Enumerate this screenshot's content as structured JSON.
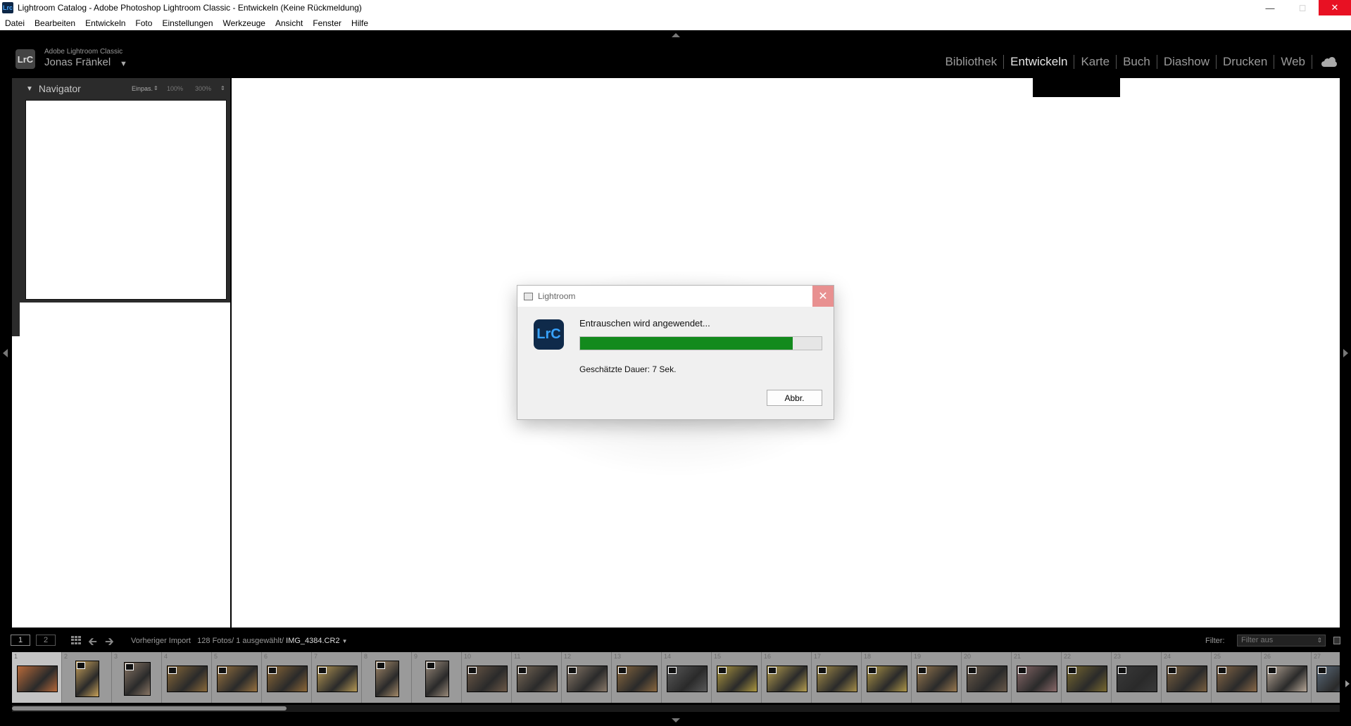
{
  "window": {
    "title": "Lightroom Catalog - Adobe Photoshop Lightroom Classic - Entwickeln (Keine Rückmeldung)",
    "app_icon": "Lrc"
  },
  "menubar": [
    "Datei",
    "Bearbeiten",
    "Entwickeln",
    "Foto",
    "Einstellungen",
    "Werkzeuge",
    "Ansicht",
    "Fenster",
    "Hilfe"
  ],
  "identity": {
    "logo": "LrC",
    "brand": "Adobe Lightroom Classic",
    "user": "Jonas Fränkel"
  },
  "modules": [
    {
      "label": "Bibliothek",
      "active": false
    },
    {
      "label": "Entwickeln",
      "active": true
    },
    {
      "label": "Karte",
      "active": false
    },
    {
      "label": "Buch",
      "active": false
    },
    {
      "label": "Diashow",
      "active": false
    },
    {
      "label": "Drucken",
      "active": false
    },
    {
      "label": "Web",
      "active": false
    }
  ],
  "navigator": {
    "title": "Navigator",
    "zoom_fit": "Einpas.",
    "zoom_100": "100%",
    "zoom_300": "300%"
  },
  "dialog": {
    "title": "Lightroom",
    "logo": "LrC",
    "message": "Entrauschen wird angewendet...",
    "progress": 0.88,
    "eta": "Geschätzte Dauer: 7 Sek.",
    "cancel_label": "Abbr."
  },
  "filmstrip_toolbar": {
    "screen1": "1",
    "screen2": "2",
    "source_prefix": "Vorheriger Import",
    "count": "128 Fotos/ 1 ausgewählt/",
    "filename": "IMG_4384.CR2",
    "filter_label": "Filter:",
    "filter_value": "Filter aus"
  },
  "filmstrip": {
    "selected_index": 1,
    "cells": [
      {
        "n": "1",
        "orient": "landscape",
        "color": "#b86a3a"
      },
      {
        "n": "2",
        "orient": "portrait",
        "color": "#caa35a"
      },
      {
        "n": "3",
        "orient": "square",
        "color": "#8a7766"
      },
      {
        "n": "4",
        "orient": "landscape",
        "color": "#8c6b3a"
      },
      {
        "n": "5",
        "orient": "landscape",
        "color": "#9a7440"
      },
      {
        "n": "6",
        "orient": "landscape",
        "color": "#8f6a38"
      },
      {
        "n": "7",
        "orient": "landscape",
        "color": "#b89a55"
      },
      {
        "n": "8",
        "orient": "portrait",
        "color": "#a58a6a"
      },
      {
        "n": "9",
        "orient": "portrait",
        "color": "#9a8a7a"
      },
      {
        "n": "10",
        "orient": "landscape",
        "color": "#6e5a48"
      },
      {
        "n": "11",
        "orient": "landscape",
        "color": "#7a6a58"
      },
      {
        "n": "12",
        "orient": "landscape",
        "color": "#8a7a6a"
      },
      {
        "n": "13",
        "orient": "landscape",
        "color": "#8c6a40"
      },
      {
        "n": "14",
        "orient": "landscape",
        "color": "#5a5a5a"
      },
      {
        "n": "15",
        "orient": "landscape",
        "color": "#b09a40"
      },
      {
        "n": "16",
        "orient": "landscape",
        "color": "#b8a050"
      },
      {
        "n": "17",
        "orient": "landscape",
        "color": "#a8904a"
      },
      {
        "n": "18",
        "orient": "landscape",
        "color": "#b09848"
      },
      {
        "n": "19",
        "orient": "landscape",
        "color": "#9a7a50"
      },
      {
        "n": "20",
        "orient": "landscape",
        "color": "#6a5a4a"
      },
      {
        "n": "21",
        "orient": "landscape",
        "color": "#8a6a6a"
      },
      {
        "n": "22",
        "orient": "landscape",
        "color": "#7a6a30"
      },
      {
        "n": "23",
        "orient": "landscape",
        "color": "#3a3a3a"
      },
      {
        "n": "24",
        "orient": "landscape",
        "color": "#7a6040"
      },
      {
        "n": "25",
        "orient": "landscape",
        "color": "#8a6a48"
      },
      {
        "n": "26",
        "orient": "landscape",
        "color": "#b8a898"
      },
      {
        "n": "27",
        "orient": "landscape",
        "color": "#5a6a7a"
      }
    ]
  },
  "icons": {
    "minimize": "minimize-icon",
    "maximize": "maximize-icon",
    "close": "close-icon",
    "cloud": "cloud-icon",
    "grid": "grid-icon",
    "prev": "arrow-left-icon",
    "next": "arrow-right-icon",
    "lock": "lock-icon"
  },
  "colors": {
    "accent_progress": "#138a1d",
    "close_red": "#e81123",
    "panel": "#2b2b2b"
  }
}
